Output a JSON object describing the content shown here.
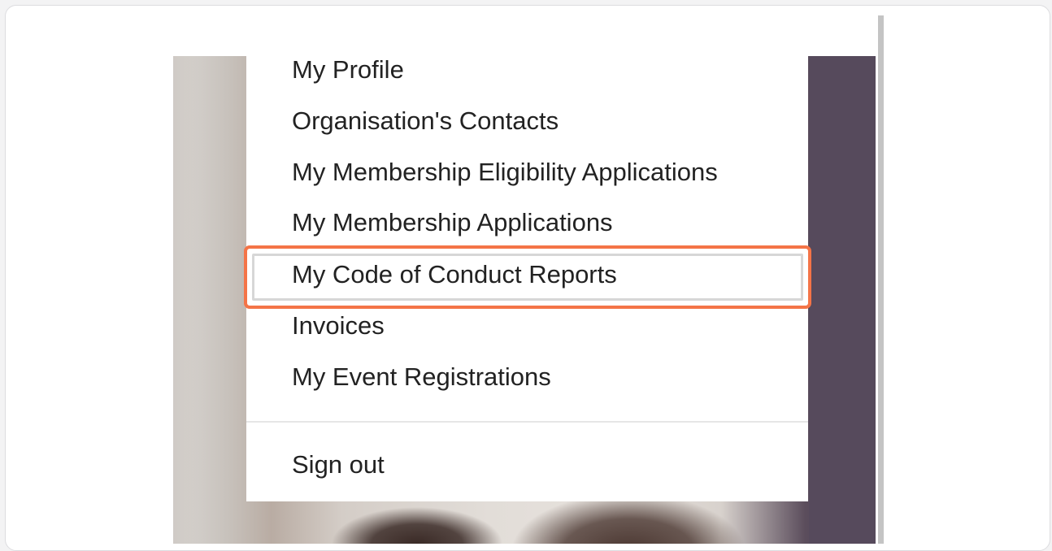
{
  "menu": {
    "items": [
      {
        "label": "My Profile"
      },
      {
        "label": "Organisation's Contacts"
      },
      {
        "label": "My Membership Eligibility Applications"
      },
      {
        "label": "My Membership Applications"
      },
      {
        "label": "My Code of Conduct Reports",
        "highlighted": true
      },
      {
        "label": "Invoices"
      },
      {
        "label": "My Event Registrations"
      }
    ],
    "sign_out": "Sign out"
  },
  "colors": {
    "highlight_border": "#f47447",
    "menu_text": "#222222",
    "background_right_panel": "#564a5c"
  }
}
